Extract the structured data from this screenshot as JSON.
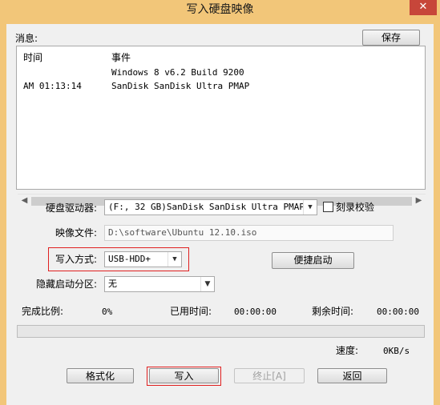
{
  "window": {
    "title": "写入硬盘映像",
    "close_label": "✕"
  },
  "messages": {
    "label": "消息:",
    "save_button": "保存",
    "columns": [
      "时间",
      "事件"
    ],
    "rows": [
      {
        "time": "",
        "event": "Windows 8 v6.2 Build 9200"
      },
      {
        "time": "AM 01:13:14",
        "event": "SanDisk SanDisk Ultra   PMAP"
      }
    ]
  },
  "drive": {
    "label": "硬盘驱动器:",
    "value": "(F:, 32 GB)SanDisk SanDisk Ultra   PMAP",
    "verify_label": "刻录校验",
    "verify_checked": false
  },
  "image_file": {
    "label": "映像文件:",
    "value": "D:\\software\\Ubuntu 12.10.iso"
  },
  "write_mode": {
    "label": "写入方式:",
    "value": "USB-HDD+"
  },
  "quick_boot_button": "便捷启动",
  "hidden_partition": {
    "label": "隐藏启动分区:",
    "value": "无"
  },
  "status": {
    "progress_label": "完成比例:",
    "progress_value": "0%",
    "progress_fraction": 0,
    "elapsed_label": "已用时间:",
    "elapsed_value": "00:00:00",
    "remaining_label": "剩余时间:",
    "remaining_value": "00:00:00",
    "speed_label": "速度:",
    "speed_value": "0KB/s"
  },
  "buttons": {
    "format": "格式化",
    "write": "写入",
    "stop": "终止[A]",
    "back": "返回"
  },
  "icons": {
    "scroll_left": "◀",
    "scroll_right": "▶",
    "dropdown": "▼"
  },
  "colors": {
    "frame": "#f2c679",
    "highlight": "#e02020",
    "progress": "#06b025"
  }
}
